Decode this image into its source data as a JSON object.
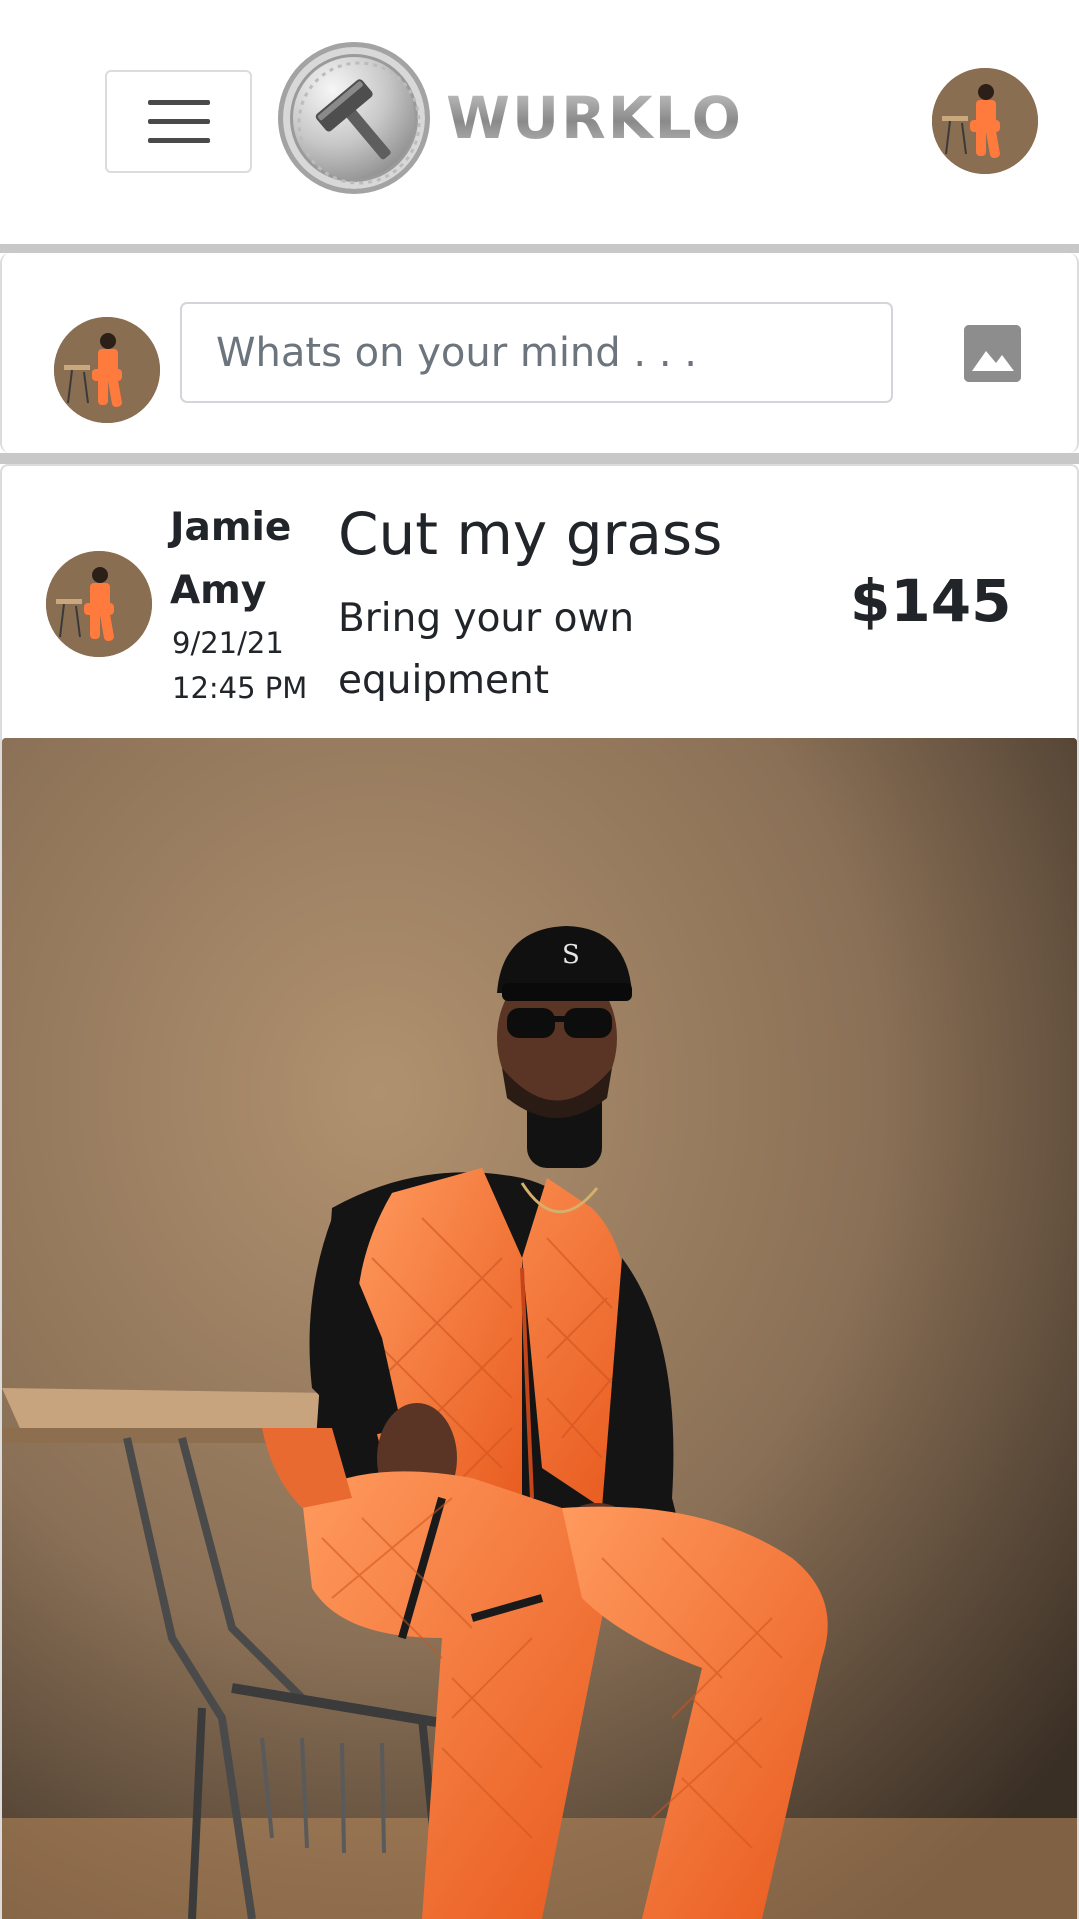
{
  "app": {
    "brand": "WURKLO",
    "colors": {
      "accent_orange": "#ff7a3d",
      "divider_gray": "#c8c8c8",
      "text_dark": "#212529"
    }
  },
  "header": {
    "menu_icon": "hamburger-menu-icon",
    "logo_icon": "hammer-coin-logo",
    "logo_text": "WURKLO",
    "profile_avatar": "user-avatar"
  },
  "composer": {
    "placeholder": "Whats on your mind . . .",
    "value": "",
    "image_icon": "image-icon"
  },
  "post": {
    "author": "Jamie Amy",
    "date": "9/21/21",
    "time": "12:45 PM",
    "title": "Cut my grass",
    "description": "Bring your own equipment",
    "price": "$145",
    "photo_icon": "post-photo"
  }
}
